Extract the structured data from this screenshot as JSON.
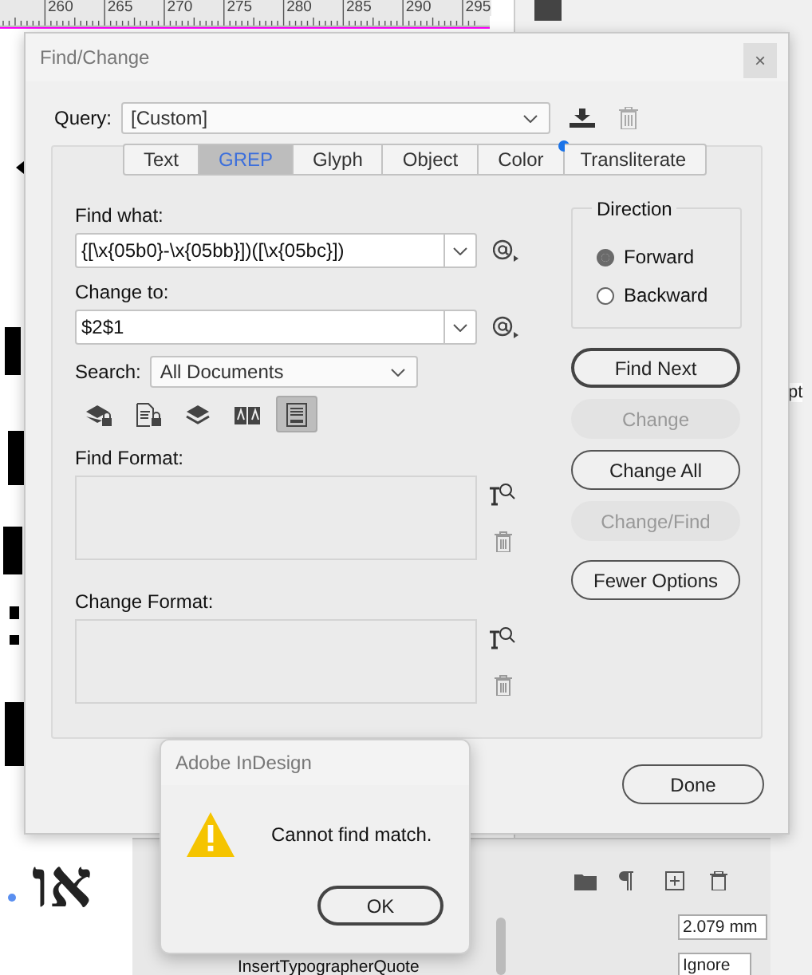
{
  "background": {
    "ruler_marks": [
      "260",
      "265",
      "270",
      "275",
      "280",
      "285",
      "290",
      "295"
    ],
    "hebrew_text": "או",
    "panel_unit": "pt",
    "panel_list_item": "InsertTypographerQuote",
    "indent_value": "2.079 mm",
    "align_value": "Ignore"
  },
  "dialog": {
    "title": "Find/Change",
    "close": "×",
    "query": {
      "label": "Query:",
      "value": "[Custom]"
    },
    "tabs": [
      {
        "label": "Text",
        "selected": false,
        "notification": false
      },
      {
        "label": "GREP",
        "selected": true,
        "notification": false
      },
      {
        "label": "Glyph",
        "selected": false,
        "notification": false
      },
      {
        "label": "Object",
        "selected": false,
        "notification": false
      },
      {
        "label": "Color",
        "selected": false,
        "notification": true
      },
      {
        "label": "Transliterate",
        "selected": false,
        "notification": false
      }
    ],
    "find_what": {
      "label": "Find what:",
      "value": "{[\\x{05b0}-\\x{05bb}])([\\x{05bc}])"
    },
    "change_to": {
      "label": "Change to:",
      "value": "$2$1"
    },
    "search": {
      "label": "Search:",
      "value": "All Documents"
    },
    "search_options": [
      {
        "kind": "locked-layers",
        "selected": false
      },
      {
        "kind": "locked-stories",
        "selected": false
      },
      {
        "kind": "hidden-layers",
        "selected": false
      },
      {
        "kind": "master-pages",
        "selected": false
      },
      {
        "kind": "footnotes",
        "selected": true
      }
    ],
    "find_format": {
      "label": "Find Format:"
    },
    "change_format": {
      "label": "Change Format:"
    },
    "direction": {
      "label": "Direction",
      "options": [
        {
          "label": "Forward",
          "selected": true
        },
        {
          "label": "Backward",
          "selected": false
        }
      ]
    },
    "buttons": [
      {
        "label": "Find Next",
        "disabled": false,
        "default": true
      },
      {
        "label": "Change",
        "disabled": true,
        "default": false
      },
      {
        "label": "Change All",
        "disabled": false,
        "default": false
      },
      {
        "label": "Change/Find",
        "disabled": true,
        "default": false
      },
      {
        "label": "Fewer Options",
        "disabled": false,
        "default": false
      }
    ],
    "done": "Done"
  },
  "alert": {
    "title": "Adobe InDesign",
    "message": "Cannot find match.",
    "button": "OK"
  }
}
